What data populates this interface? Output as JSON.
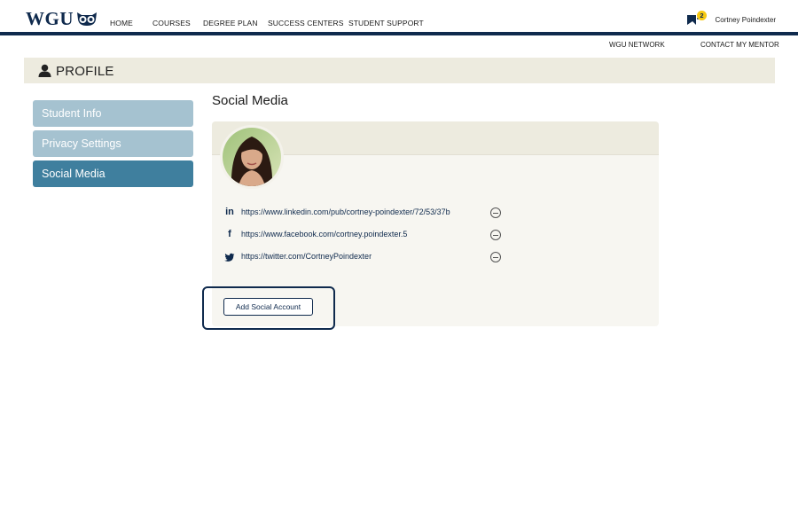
{
  "header": {
    "logo_text": "WGU",
    "nav": [
      {
        "label": "HOME"
      },
      {
        "label": "COURSES"
      },
      {
        "label": "DEGREE PLAN"
      },
      {
        "label": "SUCCESS CENTERS"
      },
      {
        "label": "STUDENT SUPPORT"
      }
    ],
    "notification_count": "2",
    "user_name": "Cortney Poindexter"
  },
  "sub_nav": {
    "network_label": "WGU NETWORK",
    "mentor_label": "CONTACT MY MENTOR"
  },
  "profile_bar": {
    "title": "PROFILE"
  },
  "sidebar": {
    "items": [
      {
        "label": "Student Info",
        "active": false
      },
      {
        "label": "Privacy Settings",
        "active": false
      },
      {
        "label": "Social Media",
        "active": true
      }
    ]
  },
  "main": {
    "section_title": "Social Media",
    "accounts": [
      {
        "network": "linkedin",
        "icon": "linkedin-icon",
        "glyph": "in",
        "url": "https://www.linkedin.com/pub/cortney-poindexter/72/53/37b"
      },
      {
        "network": "facebook",
        "icon": "facebook-icon",
        "glyph": "f",
        "url": "https://www.facebook.com/cortney.poindexter.5"
      },
      {
        "network": "twitter",
        "icon": "twitter-icon",
        "glyph": "",
        "url": "https://twitter.com/CortneyPoindexter"
      }
    ],
    "add_button_label": "Add Social Account"
  },
  "colors": {
    "navy": "#0f2a4d",
    "beige": "#edebdf",
    "sidebar_inactive": "#a5c2d0",
    "sidebar_active": "#3f7f9e",
    "badge": "#f6c913"
  }
}
